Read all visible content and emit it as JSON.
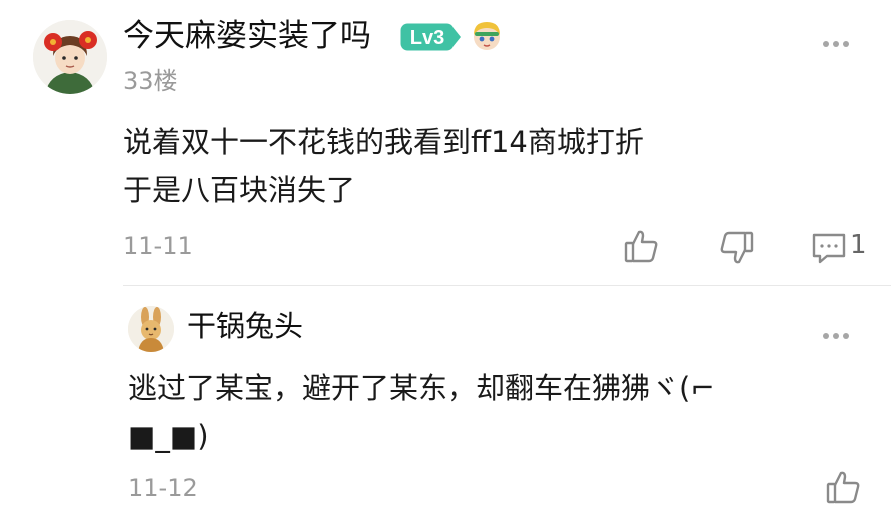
{
  "comment": {
    "username": "今天麻婆实装了吗",
    "level": "Lv3",
    "floor": "33楼",
    "text_lines": [
      "说着双十一不花钱的我看到ff14商城打折",
      "于是八百块消失了"
    ],
    "date": "11-11",
    "reply_count": "1",
    "avatar_icon": "avatar-red-flower-girl",
    "badge_icon": "mascot-icon"
  },
  "reply": {
    "username": "干锅兔头",
    "text_lines": [
      "逃过了某宝，避开了某东，却翻车在狒狒ヾ(⌐",
      "■_■)"
    ],
    "date": "11-12",
    "avatar_icon": "avatar-rabbit"
  },
  "colors": {
    "level_badge": "#3fc2a4",
    "text": "#1a1a1a",
    "meta": "#9a9a9a",
    "icon": "#8a8a8a"
  }
}
